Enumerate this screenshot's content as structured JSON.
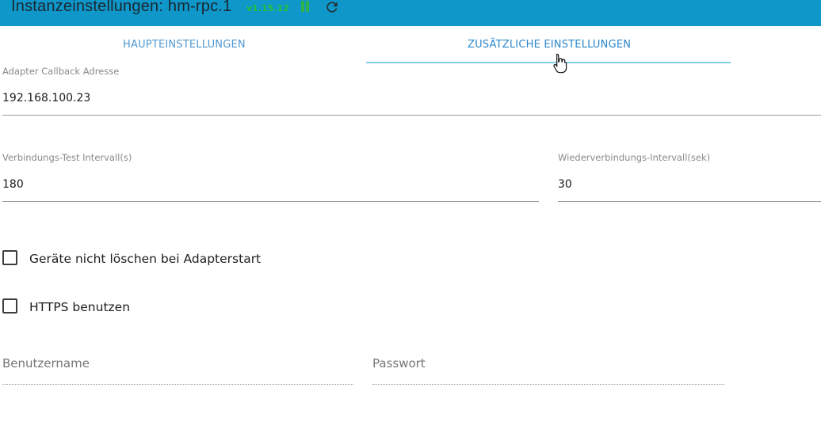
{
  "header": {
    "title": "Instanzeinstellungen: hm-rpc.1",
    "version": "v1.15.12",
    "pause_icon": "pause-icon",
    "reload_icon": "reload-icon",
    "colors": {
      "bar": "#0f97c9",
      "version": "#25c13b",
      "pause": "#2fb24b"
    }
  },
  "tabs": [
    {
      "label": "HAUPTEINSTELLUNGEN",
      "active": false
    },
    {
      "label": "ZUSÄTZLICHE EINSTELLUNGEN",
      "active": true
    }
  ],
  "fields": {
    "callback": {
      "label": "Adapter Callback Adresse",
      "value": "192.168.100.23"
    },
    "test_interval": {
      "label": "Verbindungs-Test Intervall(s)",
      "value": "180"
    },
    "reconnect_interval": {
      "label": "Wiederverbindungs-Intervall(sek)",
      "value": "30"
    },
    "username": {
      "placeholder": "Benutzername",
      "value": ""
    },
    "password": {
      "placeholder": "Passwort",
      "value": ""
    }
  },
  "checkboxes": [
    {
      "label": "Geräte nicht löschen bei Adapterstart",
      "checked": false
    },
    {
      "label": "HTTPS benutzen",
      "checked": false
    }
  ]
}
